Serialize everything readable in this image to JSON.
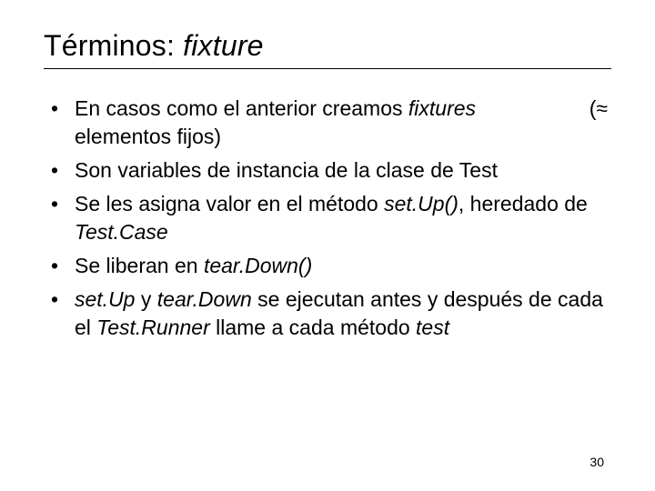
{
  "title": {
    "plain": "Términos: ",
    "italic": "fixture"
  },
  "bullets": {
    "b1": {
      "line1_a": "En casos como el anterior creamos ",
      "line1_b": "fixtures",
      "approx": "(≈",
      "line2": "elementos fijos)"
    },
    "b2": {
      "text": "Son variables de instancia de la clase de Test"
    },
    "b3": {
      "a": "Se les asigna valor en el método ",
      "b": "set.Up()",
      "c": ", heredado de ",
      "d": "Test.Case"
    },
    "b4": {
      "a": "Se liberan en ",
      "b": "tear.Down()"
    },
    "b5": {
      "a": "set.Up",
      "b": " y ",
      "c": "tear.Down",
      "d": " se ejecutan antes y después de cada el ",
      "e": "Test.Runner",
      "f": " llame a cada método ",
      "g": "test"
    }
  },
  "page_number": "30"
}
